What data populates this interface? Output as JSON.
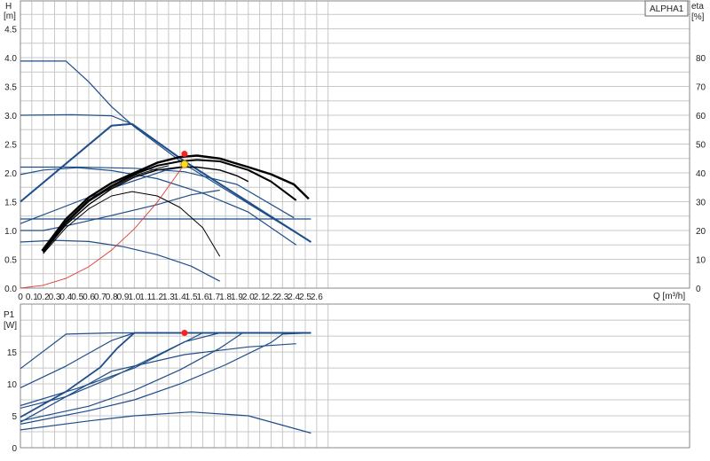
{
  "legend": {
    "label": "ALPHA1"
  },
  "top_panel": {
    "y_label": "H",
    "y_unit": "[m]",
    "y2_label": "eta",
    "y2_unit": "[%]",
    "x_unit": "Q [m³/h]"
  },
  "bottom_panel": {
    "y_label": "P1",
    "y_unit": "[W]"
  },
  "colors": {
    "curve_blue": "#1f4e8a",
    "eff_black": "#000000",
    "system_red": "#e03a3a",
    "duty_point_red": "#ff2020",
    "duty_point_yellow": "#ffe020",
    "grid": "#c8c8c8"
  },
  "chart_data": [
    {
      "type": "line",
      "panel": "head",
      "xlim": [
        0,
        2.7
      ],
      "ylim": [
        0,
        5.0
      ],
      "y2lim": [
        0,
        90
      ],
      "x_ticks": [
        "0",
        "0.1",
        "0.2",
        "0.3",
        "0.4",
        "0.5",
        "0.6",
        "0.7",
        "0.8",
        "0.9",
        "1.0",
        "1.1",
        "1.2",
        "1.3",
        "1.4",
        "1.5",
        "1.6",
        "1.7",
        "1.8",
        "1.9",
        "2.0",
        "2.1",
        "2.2",
        "2.3",
        "2.4",
        "2.5",
        "2.6"
      ],
      "y_ticks": [
        "0.0",
        "0.5",
        "1.0",
        "1.5",
        "2.0",
        "2.5",
        "3.0",
        "3.5",
        "4.0",
        "4.5"
      ],
      "y2_ticks": [
        "0",
        "10",
        "20",
        "30",
        "40",
        "50",
        "60",
        "70",
        "80"
      ],
      "grid": true,
      "head_curves": [
        {
          "width": 1.2,
          "points": [
            [
              0,
              3.94
            ],
            [
              0.4,
              3.94
            ],
            [
              0.6,
              3.58
            ],
            [
              0.8,
              3.15
            ],
            [
              1.0,
              2.8
            ],
            [
              1.44,
              2.15
            ],
            [
              2.55,
              0.8
            ]
          ]
        },
        {
          "width": 1.2,
          "points": [
            [
              0,
              3.0
            ],
            [
              0.45,
              3.01
            ],
            [
              0.8,
              2.99
            ],
            [
              1.0,
              2.83
            ]
          ]
        },
        {
          "width": 2.0,
          "points": [
            [
              0,
              1.5
            ],
            [
              0.8,
              2.82
            ],
            [
              0.98,
              2.85
            ],
            [
              1.44,
              2.2
            ],
            [
              2.55,
              0.8
            ]
          ]
        },
        {
          "width": 1.2,
          "points": [
            [
              0,
              2.1
            ],
            [
              0.5,
              2.1
            ],
            [
              1.0,
              2.08
            ],
            [
              1.44,
              2.02
            ],
            [
              1.9,
              1.8
            ],
            [
              2.4,
              1.22
            ]
          ]
        },
        {
          "width": 1.2,
          "points": [
            [
              0,
              1.97
            ],
            [
              0.2,
              2.05
            ],
            [
              0.5,
              2.09
            ],
            [
              0.8,
              2.04
            ],
            [
              1.2,
              1.9
            ],
            [
              1.6,
              1.65
            ],
            [
              2.0,
              1.32
            ],
            [
              2.42,
              0.75
            ]
          ]
        },
        {
          "width": 1.2,
          "points": [
            [
              0,
              1.2
            ],
            [
              2.55,
              1.2
            ]
          ]
        },
        {
          "width": 1.2,
          "points": [
            [
              0,
              1.12
            ],
            [
              0.5,
              1.5
            ],
            [
              0.9,
              1.8
            ],
            [
              1.3,
              2.06
            ],
            [
              1.44,
              2.1
            ]
          ]
        },
        {
          "width": 1.2,
          "points": [
            [
              0,
              1.0
            ],
            [
              0.2,
              1.0
            ],
            [
              0.4,
              1.08
            ],
            [
              0.8,
              1.26
            ],
            [
              1.2,
              1.45
            ],
            [
              1.5,
              1.62
            ],
            [
              1.75,
              1.7
            ]
          ]
        },
        {
          "width": 1.2,
          "points": [
            [
              0,
              0.8
            ],
            [
              0.3,
              0.83
            ],
            [
              0.6,
              0.81
            ],
            [
              0.9,
              0.72
            ],
            [
              1.2,
              0.58
            ],
            [
              1.5,
              0.38
            ],
            [
              1.75,
              0.12
            ]
          ]
        }
      ],
      "eta_curves": [
        {
          "width": 2.4,
          "points": [
            [
              0.19,
              13
            ],
            [
              0.4,
              24
            ],
            [
              0.6,
              31.5
            ],
            [
              0.8,
              36.5
            ],
            [
              1.0,
              40
            ],
            [
              1.2,
              43.5
            ],
            [
              1.4,
              45.5
            ],
            [
              1.55,
              46
            ],
            [
              1.75,
              45
            ],
            [
              2.0,
              42
            ],
            [
              2.2,
              39.5
            ],
            [
              2.4,
              36
            ],
            [
              2.53,
              31
            ]
          ]
        },
        {
          "width": 2.0,
          "points": [
            [
              0.2,
              12.5
            ],
            [
              0.4,
              23
            ],
            [
              0.6,
              30.5
            ],
            [
              0.8,
              35.5
            ],
            [
              1.0,
              39.5
            ],
            [
              1.2,
              42.5
            ],
            [
              1.4,
              44
            ],
            [
              1.55,
              44.5
            ],
            [
              1.75,
              44
            ],
            [
              2.0,
              41
            ],
            [
              2.2,
              37
            ],
            [
              2.42,
              30.5
            ]
          ]
        },
        {
          "width": 1.4,
          "points": [
            [
              0.2,
              12.5
            ],
            [
              0.4,
              22
            ],
            [
              0.6,
              29
            ],
            [
              0.8,
              34.5
            ],
            [
              1.0,
              38.5
            ],
            [
              1.2,
              41
            ],
            [
              1.4,
              42
            ],
            [
              1.55,
              42
            ],
            [
              1.75,
              41
            ],
            [
              1.9,
              39
            ],
            [
              2.0,
              37
            ]
          ]
        },
        {
          "width": 1.0,
          "points": [
            [
              0.2,
              12
            ],
            [
              0.4,
              21
            ],
            [
              0.6,
              27.5
            ],
            [
              0.8,
              32
            ],
            [
              0.98,
              33.5
            ],
            [
              1.2,
              32
            ],
            [
              1.4,
              28
            ],
            [
              1.6,
              21
            ],
            [
              1.75,
              11
            ]
          ]
        },
        {
          "width": 1.0,
          "points": [
            [
              0.19,
              13
            ],
            [
              0.4,
              22.5
            ],
            [
              0.6,
              30
            ],
            [
              0.8,
              35
            ],
            [
              1.0,
              39
            ],
            [
              1.2,
              41.5
            ],
            [
              1.3,
              42.5
            ]
          ]
        }
      ],
      "system_curve": [
        [
          0,
          0
        ],
        [
          0.2,
          0.05
        ],
        [
          0.4,
          0.17
        ],
        [
          0.6,
          0.37
        ],
        [
          0.8,
          0.66
        ],
        [
          1.0,
          1.03
        ],
        [
          1.2,
          1.49
        ],
        [
          1.44,
          2.15
        ]
      ],
      "duty_points_head": [
        {
          "x": 1.44,
          "y": 2.33,
          "color": "red"
        },
        {
          "x": 1.44,
          "y": 2.15,
          "color": "yellow"
        }
      ]
    },
    {
      "type": "line",
      "panel": "power",
      "xlim": [
        0,
        2.7
      ],
      "ylim": [
        0,
        20
      ],
      "y_ticks": [
        "0",
        "5",
        "10",
        "15"
      ],
      "grid": true,
      "power_curves": [
        {
          "width": 1.2,
          "points": [
            [
              0,
              12.4
            ],
            [
              0.4,
              17.8
            ],
            [
              0.8,
              18.0
            ],
            [
              2.55,
              18.0
            ]
          ]
        },
        {
          "width": 1.2,
          "points": [
            [
              0,
              9.4
            ],
            [
              0.4,
              12.8
            ],
            [
              0.8,
              16.8
            ],
            [
              1.0,
              18.0
            ],
            [
              2.55,
              18.0
            ]
          ]
        },
        {
          "width": 1.8,
          "points": [
            [
              0,
              4.8
            ],
            [
              0.4,
              8.8
            ],
            [
              0.7,
              12.6
            ],
            [
              0.85,
              15.6
            ],
            [
              1.0,
              18.0
            ],
            [
              2.55,
              18.0
            ]
          ]
        },
        {
          "width": 1.2,
          "points": [
            [
              0,
              6.6
            ],
            [
              0.5,
              9.3
            ],
            [
              1.0,
              12.5
            ],
            [
              1.4,
              16.2
            ],
            [
              1.6,
              18.0
            ],
            [
              2.55,
              18.0
            ]
          ]
        },
        {
          "width": 1.2,
          "points": [
            [
              0,
              6.2
            ],
            [
              0.4,
              8.0
            ],
            [
              0.8,
              11.0
            ],
            [
              1.2,
              14.5
            ],
            [
              1.44,
              16.6
            ],
            [
              1.75,
              18.0
            ],
            [
              2.55,
              18.0
            ]
          ]
        },
        {
          "width": 1.2,
          "points": [
            [
              0,
              4.2
            ],
            [
              0.6,
              6.5
            ],
            [
              1.0,
              9.0
            ],
            [
              1.4,
              12.2
            ],
            [
              1.75,
              15.6
            ],
            [
              1.95,
              18.0
            ],
            [
              2.55,
              18.0
            ]
          ]
        },
        {
          "width": 1.2,
          "points": [
            [
              0,
              3.7
            ],
            [
              0.6,
              5.8
            ],
            [
              1.0,
              7.5
            ],
            [
              1.4,
              10.0
            ],
            [
              1.8,
              13.0
            ],
            [
              2.2,
              16.5
            ],
            [
              2.3,
              17.8
            ],
            [
              2.55,
              18.0
            ]
          ]
        },
        {
          "width": 1.2,
          "points": [
            [
              0,
              4.0
            ],
            [
              0.8,
              12.0
            ],
            [
              1.44,
              14.6
            ],
            [
              2.0,
              15.8
            ],
            [
              2.42,
              16.3
            ]
          ]
        },
        {
          "width": 1.2,
          "points": [
            [
              0,
              2.8
            ],
            [
              0.6,
              4.2
            ],
            [
              1.0,
              5.0
            ],
            [
              1.5,
              5.6
            ],
            [
              2.0,
              5.0
            ],
            [
              2.55,
              2.3
            ]
          ]
        }
      ],
      "duty_points_power": [
        {
          "x": 1.44,
          "y": 18.0,
          "color": "red"
        }
      ]
    }
  ]
}
